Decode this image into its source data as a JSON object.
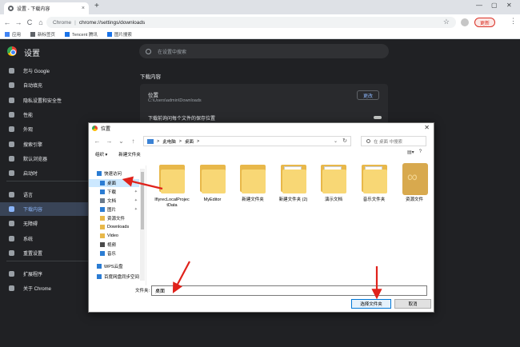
{
  "browser": {
    "tab_title": "设置 - 下载内容",
    "tab_close": "×",
    "new_tab": "+",
    "window_buttons": [
      "—",
      "▢",
      "✕"
    ],
    "nav": {
      "back": "←",
      "forward": "→",
      "reload": "C",
      "home": "⌂"
    },
    "address_site": "Chrome",
    "address_sep": "|",
    "address_url": "chrome://settings/downloads",
    "update_label": "更新",
    "bookmarks": [
      {
        "label": "应用",
        "icon": "apps-grid-icon",
        "color": "#4285f4"
      },
      {
        "label": "新标签页",
        "icon": "new-tab-icon",
        "color": "#5f6368"
      },
      {
        "label": "Tencent 腾讯",
        "icon": "tencent-icon",
        "color": "#1a73e8"
      },
      {
        "label": "图片搜索",
        "icon": "image-search-icon",
        "color": "#1a73e8"
      }
    ]
  },
  "settings": {
    "title": "设置",
    "search_placeholder": "在设置中搜索",
    "nav_items": [
      {
        "label": "您与 Google",
        "icon": "person-icon"
      },
      {
        "label": "自动填充",
        "icon": "autofill-icon"
      },
      {
        "label": "隐私设置和安全性",
        "icon": "shield-icon"
      },
      {
        "label": "性能",
        "icon": "speed-icon"
      },
      {
        "label": "外观",
        "icon": "palette-icon"
      },
      {
        "label": "搜索引擎",
        "icon": "search-icon"
      },
      {
        "label": "默认浏览器",
        "icon": "browser-icon"
      },
      {
        "label": "启动时",
        "icon": "power-icon"
      },
      {
        "label": "语言",
        "icon": "globe-icon"
      },
      {
        "label": "下载内容",
        "icon": "download-icon",
        "active": true
      },
      {
        "label": "无障碍",
        "icon": "accessibility-icon"
      },
      {
        "label": "系统",
        "icon": "wrench-icon"
      },
      {
        "label": "重置设置",
        "icon": "reset-icon"
      },
      {
        "label": "扩展程序",
        "icon": "extension-icon"
      },
      {
        "label": "关于 Chrome",
        "icon": "chrome-logo-icon"
      }
    ],
    "downloads_heading": "下载内容",
    "location_label": "位置",
    "location_path": "C:\\Users\\admin\\Downloads",
    "change_button": "更改",
    "ask_label": "下载前询问每个文件的保存位置"
  },
  "dialog": {
    "title": "位置",
    "close": "✕",
    "breadcrumb": [
      "此电脑",
      "桌面"
    ],
    "breadcrumb_sep": ">",
    "search_placeholder": "在 桌面 中搜索",
    "cmd_organize": "组织 ▾",
    "cmd_new_folder": "新建文件夹",
    "quick_items": [
      {
        "label": "快速访问",
        "icon": "star-icon",
        "color": "#2b7cd3"
      },
      {
        "label": "桌面",
        "icon": "desktop-icon",
        "color": "#2b7cd3",
        "selected": true
      },
      {
        "label": "下载",
        "icon": "download-arrow-icon",
        "color": "#2b7cd3"
      },
      {
        "label": "文档",
        "icon": "document-icon",
        "color": "#6b7b8c"
      },
      {
        "label": "图片",
        "icon": "picture-icon",
        "color": "#2b7cd3"
      },
      {
        "label": "资源文件",
        "icon": "folder-icon",
        "color": "#e8b84a"
      },
      {
        "label": "Downloads",
        "icon": "folder-icon",
        "color": "#e8b84a"
      },
      {
        "label": "Video",
        "icon": "folder-icon",
        "color": "#e8b84a"
      },
      {
        "label": "视频",
        "icon": "video-icon",
        "color": "#4a4a4a"
      },
      {
        "label": "音乐",
        "icon": "music-icon",
        "color": "#2b7cd3"
      },
      {
        "label": "WPS云盘",
        "icon": "cloud-icon",
        "color": "#2b7cd3"
      },
      {
        "label": "百度网盘同步空间",
        "icon": "baidu-cloud-icon",
        "color": "#2b7cd3"
      }
    ],
    "files": [
      {
        "name": "IflyrecLocalProjectData",
        "kind": "folder"
      },
      {
        "name": "MyEditor",
        "kind": "folder"
      },
      {
        "name": "新建文件夹",
        "kind": "folder"
      },
      {
        "name": "新建文件夹 (2)",
        "kind": "folder-doc"
      },
      {
        "name": "演示文档",
        "kind": "folder-doc"
      },
      {
        "name": "音乐文件夹",
        "kind": "folder-doc"
      },
      {
        "name": "资源文件",
        "kind": "resource"
      }
    ],
    "folder_label": "文件夹:",
    "folder_value": "桌面",
    "select_button": "选择文件夹",
    "cancel_button": "取消"
  },
  "colors": {
    "accent_red": "#e0221b",
    "active_nav": "#8ab4f8"
  }
}
